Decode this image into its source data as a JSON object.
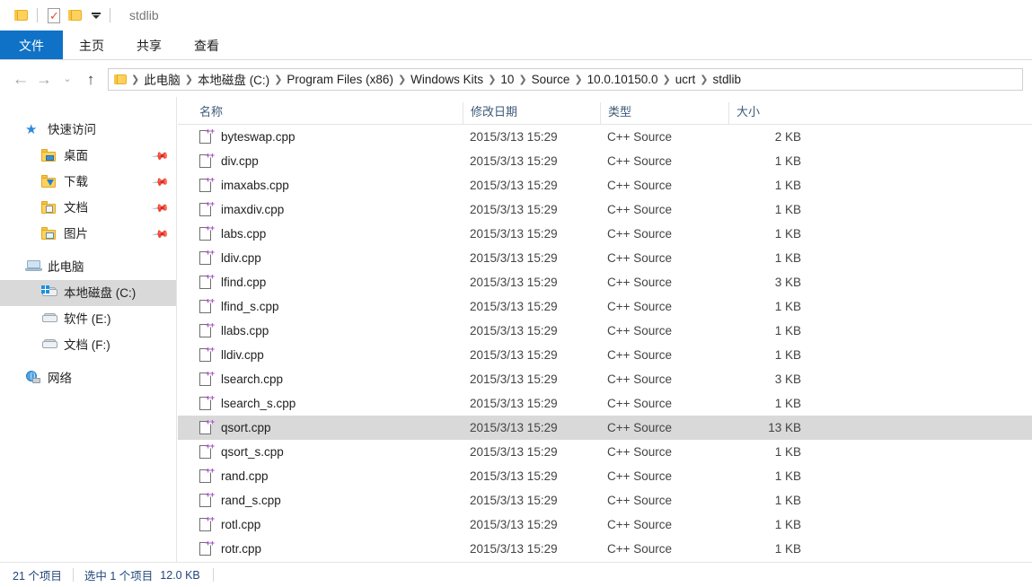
{
  "window": {
    "title": "stdlib",
    "quick_access": {
      "folder_icon": "folder-icon",
      "properties_icon": "properties-checkmark-icon",
      "new_folder_icon": "new-folder-icon",
      "dropdown_icon": "chevron-down-icon"
    }
  },
  "ribbon": {
    "tabs": [
      {
        "label": "文件",
        "active": true
      },
      {
        "label": "主页",
        "active": false
      },
      {
        "label": "共享",
        "active": false
      },
      {
        "label": "查看",
        "active": false
      }
    ]
  },
  "navbar": {
    "back_icon": "←",
    "forward_icon": "→",
    "recent_icon": "⌄",
    "up_icon": "↑",
    "breadcrumb_sep": "❯",
    "breadcrumbs": [
      "此电脑",
      "本地磁盘 (C:)",
      "Program Files (x86)",
      "Windows Kits",
      "10",
      "Source",
      "10.0.10150.0",
      "ucrt",
      "stdlib"
    ]
  },
  "sidebar": {
    "items": [
      {
        "label": "快速访问",
        "icon": "star-icon",
        "level": "root",
        "pin": false,
        "selected": false
      },
      {
        "label": "桌面",
        "icon": "folder-desktop-icon",
        "level": "child",
        "pin": true,
        "selected": false
      },
      {
        "label": "下载",
        "icon": "folder-downloads-icon",
        "level": "child",
        "pin": true,
        "selected": false
      },
      {
        "label": "文档",
        "icon": "folder-documents-icon",
        "level": "child",
        "pin": true,
        "selected": false
      },
      {
        "label": "图片",
        "icon": "folder-pictures-icon",
        "level": "child",
        "pin": true,
        "selected": false
      },
      {
        "label": "此电脑",
        "icon": "this-pc-icon",
        "level": "root",
        "pin": false,
        "selected": false
      },
      {
        "label": "本地磁盘 (C:)",
        "icon": "windows-drive-icon",
        "level": "child",
        "pin": false,
        "selected": true
      },
      {
        "label": "软件 (E:)",
        "icon": "drive-icon",
        "level": "child",
        "pin": false,
        "selected": false
      },
      {
        "label": "文档 (F:)",
        "icon": "drive-icon",
        "level": "child",
        "pin": false,
        "selected": false
      },
      {
        "label": "网络",
        "icon": "network-icon",
        "level": "root",
        "pin": false,
        "selected": false
      }
    ]
  },
  "filelist": {
    "columns": {
      "name": "名称",
      "date": "修改日期",
      "type": "类型",
      "size": "大小"
    },
    "sort": {
      "column": "名称",
      "direction": "asc",
      "caret": "⌃"
    },
    "rows": [
      {
        "name": "byteswap.cpp",
        "date": "2015/3/13 15:29",
        "type": "C++ Source",
        "size": "2 KB",
        "selected": false
      },
      {
        "name": "div.cpp",
        "date": "2015/3/13 15:29",
        "type": "C++ Source",
        "size": "1 KB",
        "selected": false
      },
      {
        "name": "imaxabs.cpp",
        "date": "2015/3/13 15:29",
        "type": "C++ Source",
        "size": "1 KB",
        "selected": false
      },
      {
        "name": "imaxdiv.cpp",
        "date": "2015/3/13 15:29",
        "type": "C++ Source",
        "size": "1 KB",
        "selected": false
      },
      {
        "name": "labs.cpp",
        "date": "2015/3/13 15:29",
        "type": "C++ Source",
        "size": "1 KB",
        "selected": false
      },
      {
        "name": "ldiv.cpp",
        "date": "2015/3/13 15:29",
        "type": "C++ Source",
        "size": "1 KB",
        "selected": false
      },
      {
        "name": "lfind.cpp",
        "date": "2015/3/13 15:29",
        "type": "C++ Source",
        "size": "3 KB",
        "selected": false
      },
      {
        "name": "lfind_s.cpp",
        "date": "2015/3/13 15:29",
        "type": "C++ Source",
        "size": "1 KB",
        "selected": false
      },
      {
        "name": "llabs.cpp",
        "date": "2015/3/13 15:29",
        "type": "C++ Source",
        "size": "1 KB",
        "selected": false
      },
      {
        "name": "lldiv.cpp",
        "date": "2015/3/13 15:29",
        "type": "C++ Source",
        "size": "1 KB",
        "selected": false
      },
      {
        "name": "lsearch.cpp",
        "date": "2015/3/13 15:29",
        "type": "C++ Source",
        "size": "3 KB",
        "selected": false
      },
      {
        "name": "lsearch_s.cpp",
        "date": "2015/3/13 15:29",
        "type": "C++ Source",
        "size": "1 KB",
        "selected": false
      },
      {
        "name": "qsort.cpp",
        "date": "2015/3/13 15:29",
        "type": "C++ Source",
        "size": "13 KB",
        "selected": true
      },
      {
        "name": "qsort_s.cpp",
        "date": "2015/3/13 15:29",
        "type": "C++ Source",
        "size": "1 KB",
        "selected": false
      },
      {
        "name": "rand.cpp",
        "date": "2015/3/13 15:29",
        "type": "C++ Source",
        "size": "1 KB",
        "selected": false
      },
      {
        "name": "rand_s.cpp",
        "date": "2015/3/13 15:29",
        "type": "C++ Source",
        "size": "1 KB",
        "selected": false
      },
      {
        "name": "rotl.cpp",
        "date": "2015/3/13 15:29",
        "type": "C++ Source",
        "size": "1 KB",
        "selected": false
      },
      {
        "name": "rotr.cpp",
        "date": "2015/3/13 15:29",
        "type": "C++ Source",
        "size": "1 KB",
        "selected": false
      }
    ]
  },
  "statusbar": {
    "item_count": "21 个项目",
    "selection": "选中 1 个项目",
    "selection_size": "12.0 KB"
  },
  "colors": {
    "accent_blue": "#1072c6",
    "selection_gray": "#d9d9d9",
    "header_text": "#3c5a78",
    "status_text": "#22477a",
    "folder_yellow": "#fdd25c"
  }
}
